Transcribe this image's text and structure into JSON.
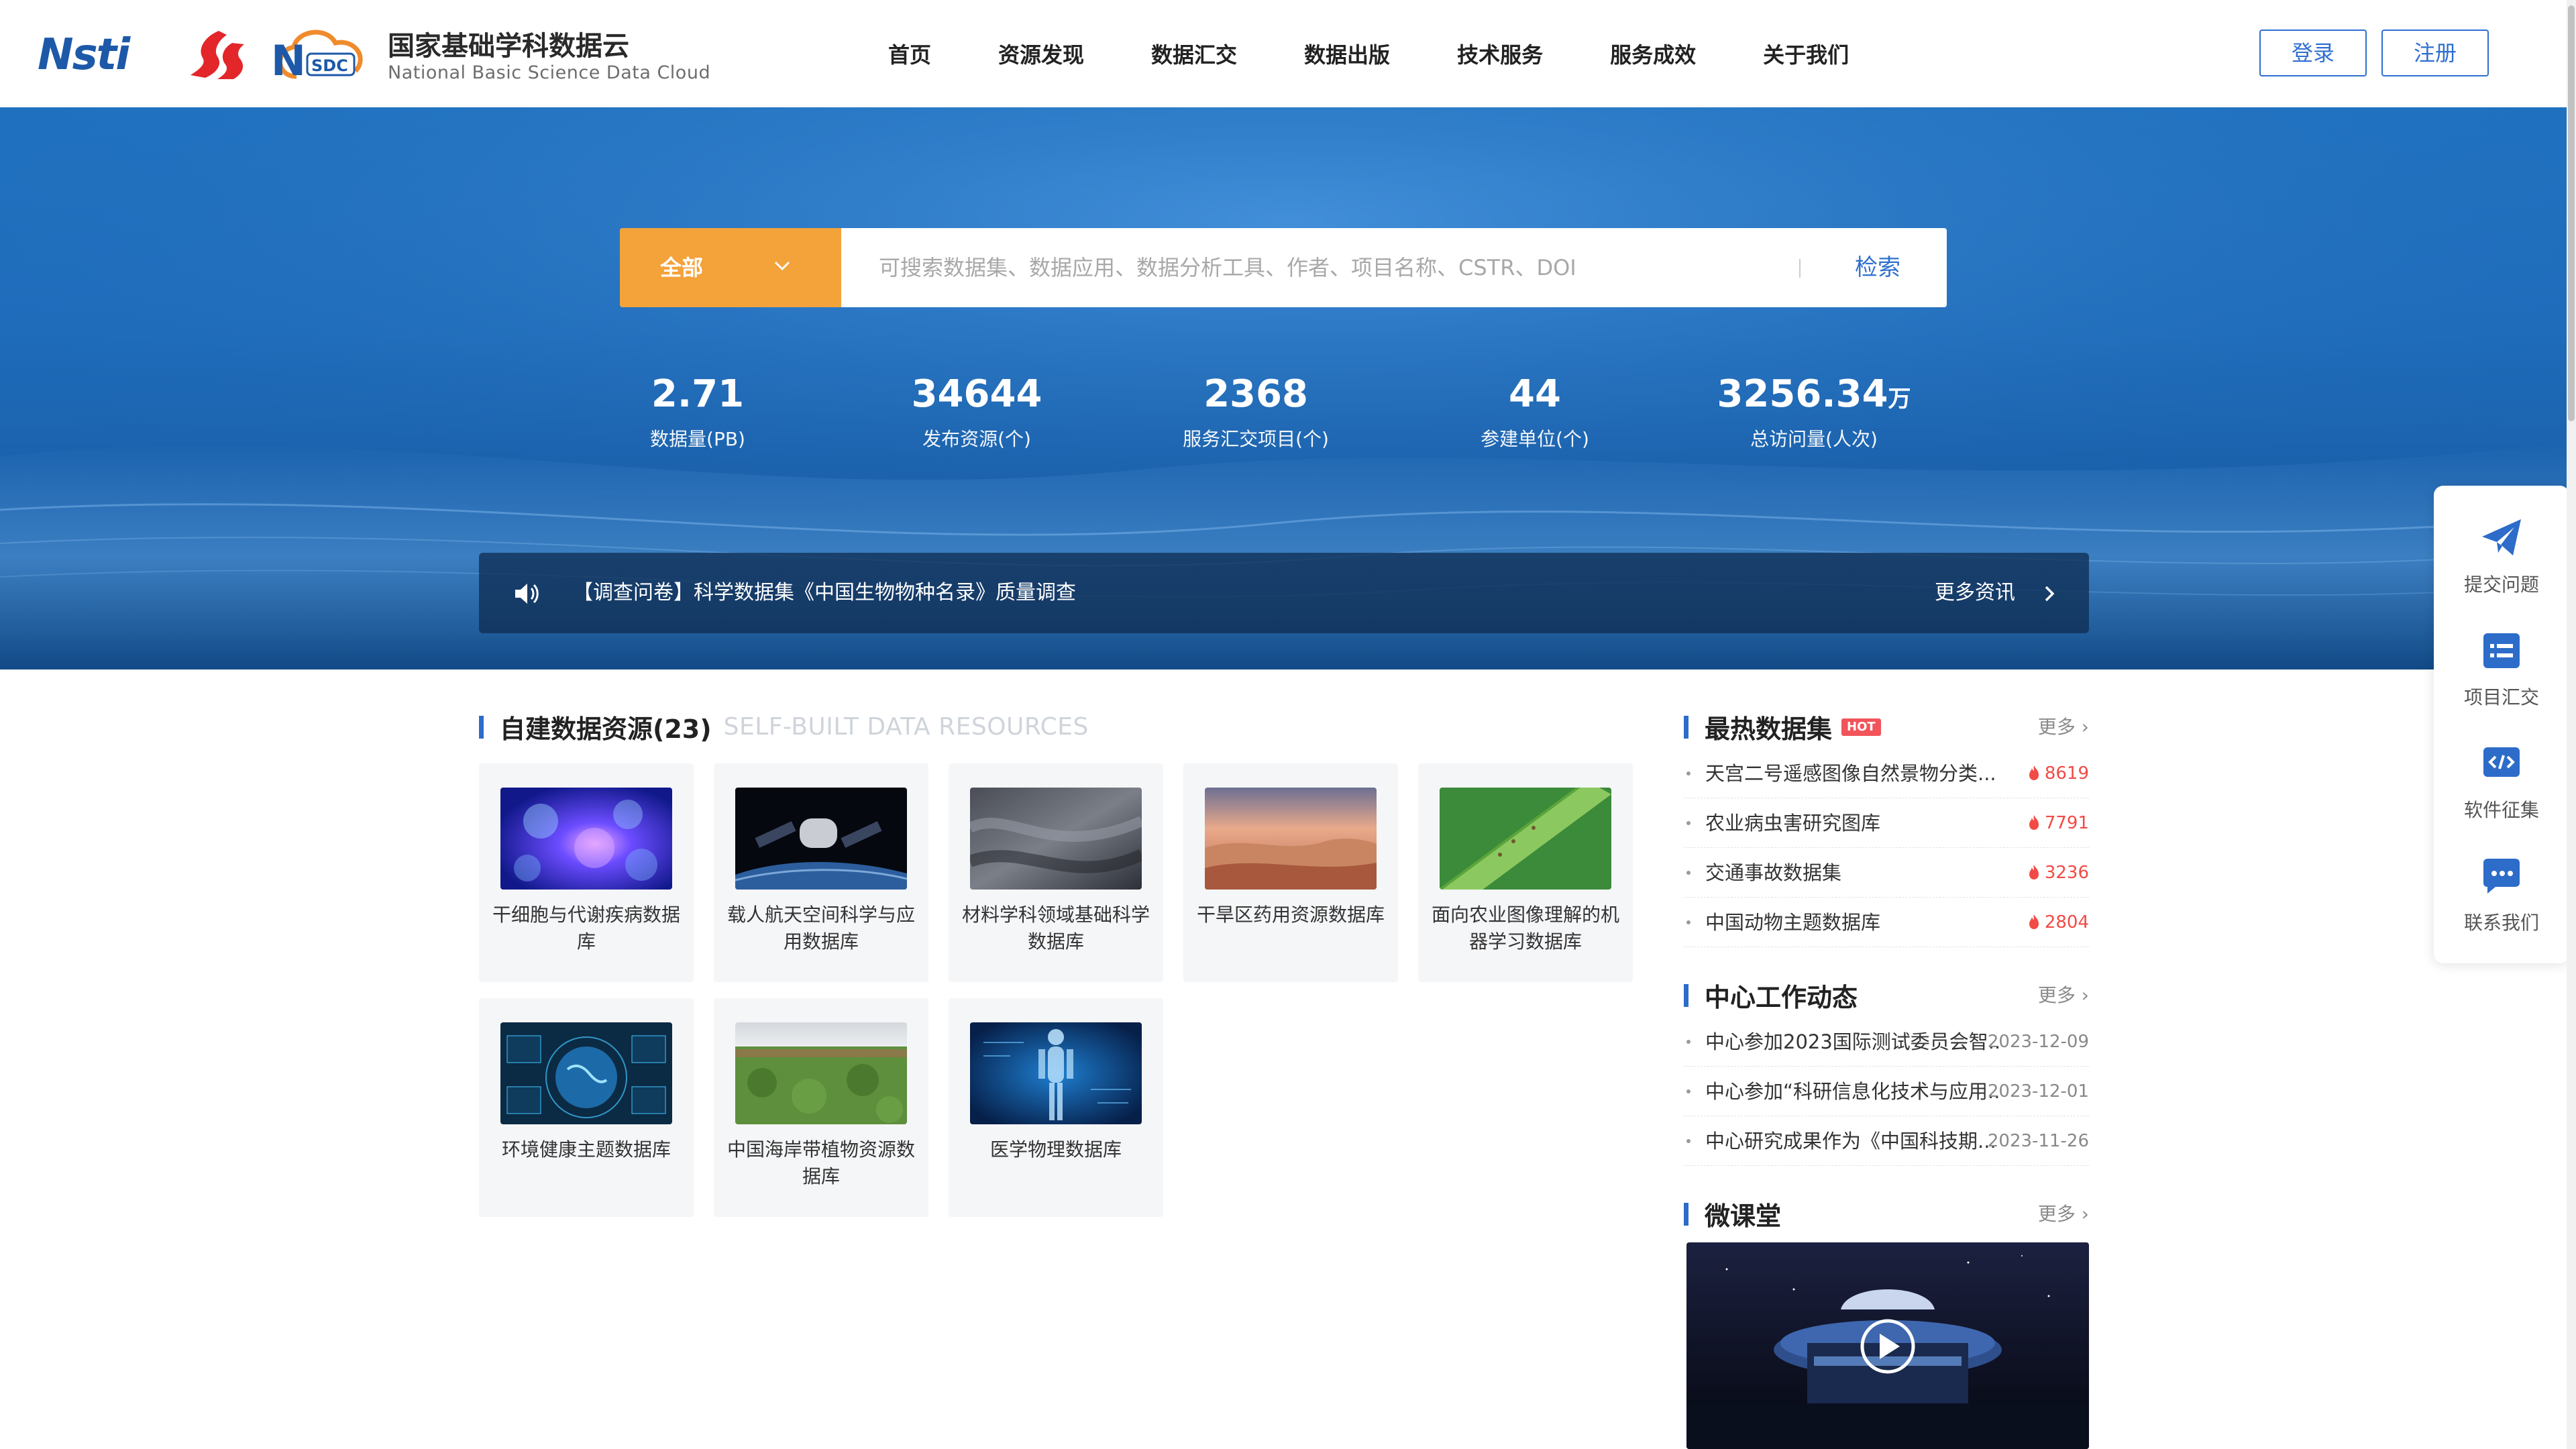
{
  "header": {
    "logo_cstr_text": "Nsti",
    "site_name_cn": "国家基础学科数据云",
    "site_name_en": "National Basic Science Data Cloud",
    "nav": [
      "首页",
      "资源发现",
      "数据汇交",
      "数据出版",
      "技术服务",
      "服务成效",
      "关于我们"
    ],
    "login_label": "登录",
    "register_label": "注册"
  },
  "search": {
    "category": "全部",
    "placeholder": "可搜索数据集、数据应用、数据分析工具、作者、项目名称、CSTR、DOI",
    "button_label": "检索"
  },
  "stats": [
    {
      "value": "2.71",
      "unit": "",
      "label": "数据量(PB)"
    },
    {
      "value": "34644",
      "unit": "",
      "label": "发布资源(个)"
    },
    {
      "value": "2368",
      "unit": "",
      "label": "服务汇交项目(个)"
    },
    {
      "value": "44",
      "unit": "",
      "label": "参建单位(个)"
    },
    {
      "value": "3256.34",
      "unit": "万",
      "label": "总访问量(人次)"
    }
  ],
  "notice": {
    "text": "【调查问卷】科学数据集《中国生物物种名录》质量调查",
    "more_label": "更多资讯"
  },
  "resources": {
    "title": "自建数据资源(23)",
    "subtitle": "SELF-BUILT DATA RESOURCES",
    "cards": [
      {
        "title": "干细胞与代谢疾病数据库",
        "thumb": "cells-image"
      },
      {
        "title": "载人航天空间科学与应用数据库",
        "thumb": "space-station-image"
      },
      {
        "title": "材料学科领域基础科学数据库",
        "thumb": "fabric-image"
      },
      {
        "title": "干旱区药用资源数据库",
        "thumb": "desert-image"
      },
      {
        "title": "面向农业图像理解的机器学习数据库",
        "thumb": "leaf-image"
      },
      {
        "title": "环境健康主题数据库",
        "thumb": "globe-dashboard-image"
      },
      {
        "title": "中国海岸带植物资源数据库",
        "thumb": "field-image"
      },
      {
        "title": "医学物理数据库",
        "thumb": "human-body-image"
      }
    ]
  },
  "hot": {
    "title": "最热数据集",
    "badge": "HOT",
    "more": "更多",
    "items": [
      {
        "title": "天宫二号遥感图像自然景物分类...",
        "count": "8619"
      },
      {
        "title": "农业病虫害研究图库",
        "count": "7791"
      },
      {
        "title": "交通事故数据集",
        "count": "3236"
      },
      {
        "title": "中国动物主题数据库",
        "count": "2804"
      }
    ]
  },
  "news": {
    "title": "中心工作动态",
    "more": "更多",
    "items": [
      {
        "title": "中心参加2023国际测试委员会智...",
        "date": "2023-12-09"
      },
      {
        "title": "中心参加“科研信息化技术与应用...",
        "date": "2023-12-01"
      },
      {
        "title": "中心研究成果作为《中国科技期...",
        "date": "2023-11-26"
      }
    ]
  },
  "micro": {
    "title": "微课堂",
    "more": "更多"
  },
  "float_bar": [
    "提交问题",
    "项目汇交",
    "软件征集",
    "联系我们"
  ],
  "colors": {
    "brand_blue": "#2d6cc9",
    "search_orange": "#f4a23a",
    "hot_red": "#f24a45"
  }
}
